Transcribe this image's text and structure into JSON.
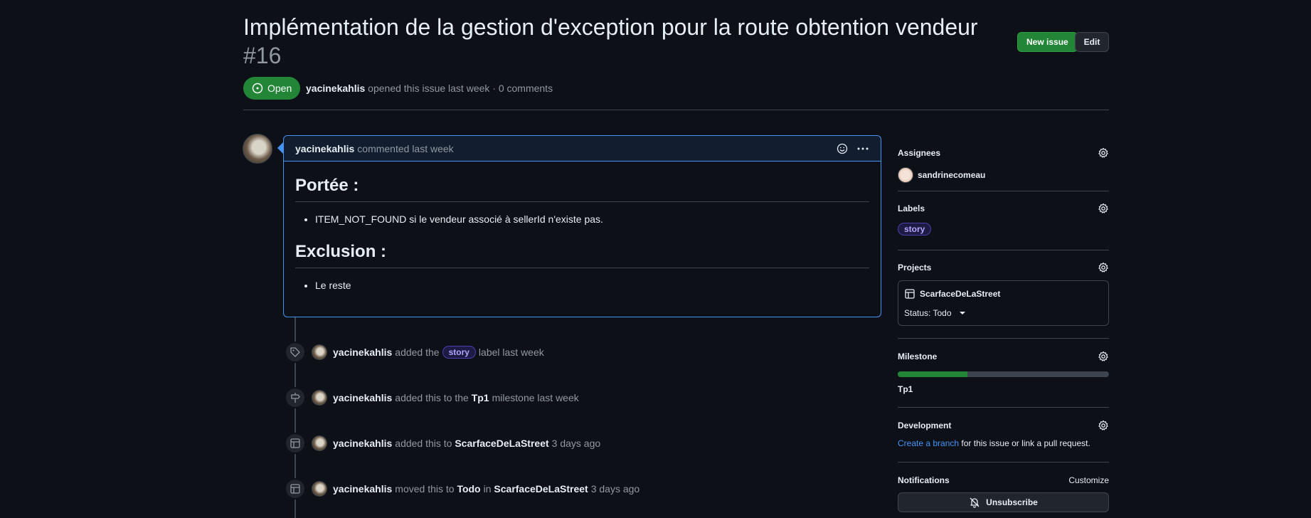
{
  "issue": {
    "title": "Implémentation de la gestion d'exception pour la route obtention vendeur",
    "number": "#16",
    "state": "Open",
    "author": "yacinekahlis",
    "meta_text": "opened this issue last week · 0 comments"
  },
  "header": {
    "new_issue_label": "New issue",
    "edit_label": "Edit"
  },
  "comment": {
    "author": "yacinekahlis",
    "meta": "commented last week",
    "sections": [
      {
        "heading": "Portée :",
        "item": "ITEM_NOT_FOUND si le vendeur associé à sellerId n'existe pas."
      },
      {
        "heading": "Exclusion :",
        "item": "Le reste"
      }
    ]
  },
  "timeline": [
    {
      "icon": "tag-icon",
      "author": "yacinekahlis",
      "pre": "added the",
      "label": "story",
      "post": "label last week"
    },
    {
      "icon": "milestone-icon",
      "author": "yacinekahlis",
      "pre": "added this to the",
      "strong": "Tp1",
      "post": "milestone last week"
    },
    {
      "icon": "table-icon",
      "author": "yacinekahlis",
      "pre": "added this to",
      "strong": "ScarfaceDeLaStreet",
      "post": "3 days ago"
    },
    {
      "icon": "table-icon",
      "author": "yacinekahlis",
      "pre": "moved this to",
      "strong": "Todo",
      "mid": "in",
      "strong2": "ScarfaceDeLaStreet",
      "post": "3 days ago"
    }
  ],
  "sidebar": {
    "assignees": {
      "title": "Assignees",
      "user": "sandrinecomeau"
    },
    "labels": {
      "title": "Labels",
      "label": "story"
    },
    "projects": {
      "title": "Projects",
      "name": "ScarfaceDeLaStreet",
      "status": "Status: Todo"
    },
    "milestone": {
      "title": "Milestone",
      "name": "Tp1",
      "progress": 0.33
    },
    "development": {
      "title": "Development",
      "link": "Create a branch",
      "rest": "for this issue or link a pull request."
    },
    "notifications": {
      "title": "Notifications",
      "customize": "Customize",
      "unsubscribe": "Unsubscribe"
    }
  },
  "colors": {
    "accent": "#4493f8",
    "open": "#238636",
    "label_story": "#b3a6ff"
  }
}
